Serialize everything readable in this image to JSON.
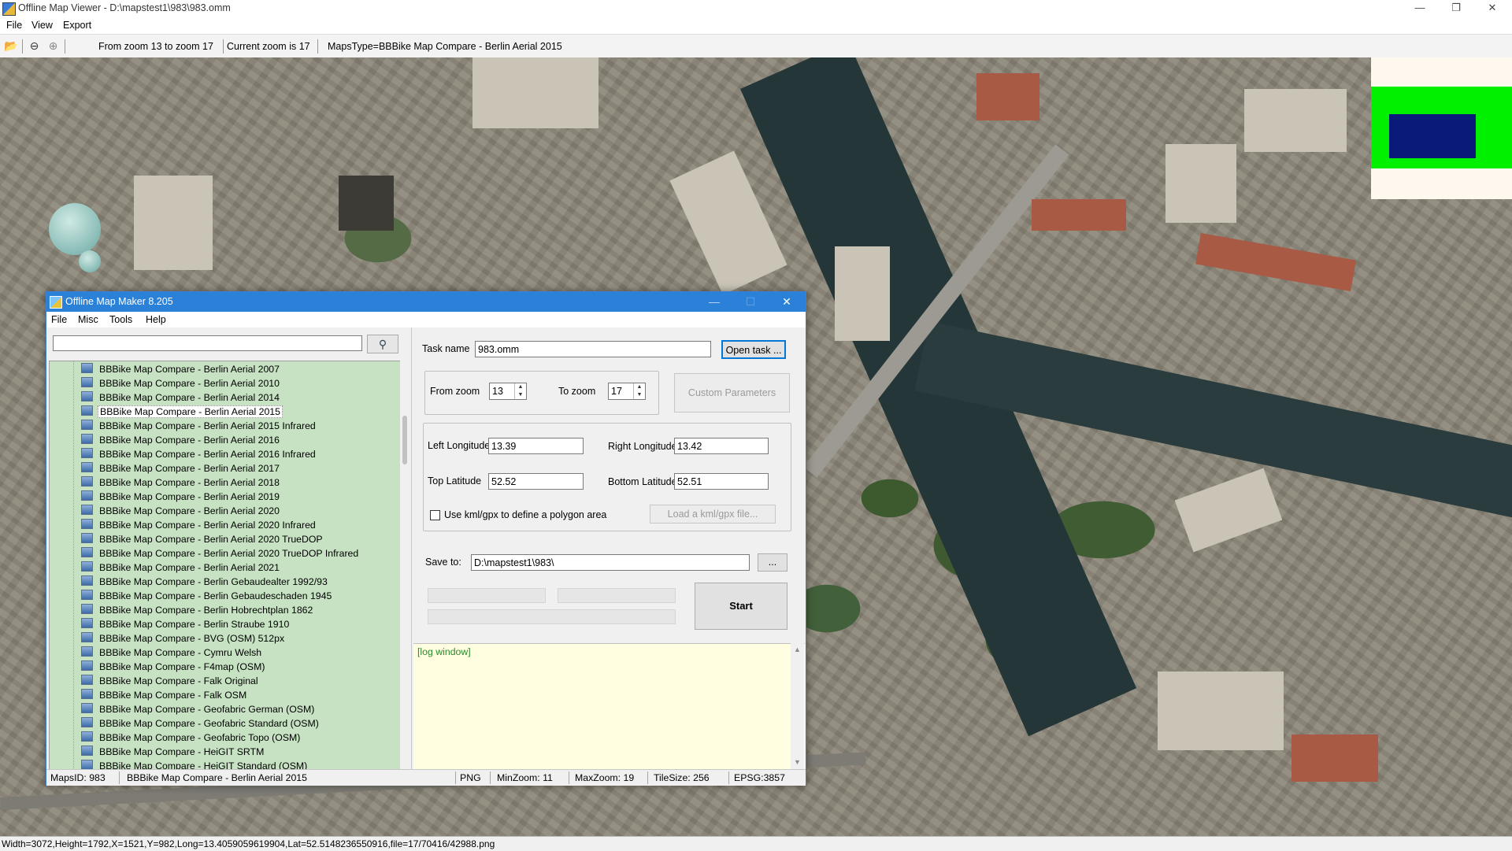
{
  "viewer": {
    "title": "Offline Map Viewer - D:\\mapstest1\\983\\983.omm",
    "menu": [
      "File",
      "View",
      "Export"
    ],
    "toolbar": {
      "zoom_range": "From zoom 13 to zoom 17",
      "current_zoom": "Current zoom is 17",
      "maps_type": "MapsType=BBBike Map Compare - Berlin Aerial 2015"
    },
    "window_buttons": {
      "minimize": "—",
      "restore": "❐",
      "close": "✕"
    },
    "status": "Width=3072,Height=1792,X=1521,Y=982,Long=13.4059059619904,Lat=52.5148236550916,file=17/70416/42988.png"
  },
  "dialog": {
    "title": "Offline Map Maker 8.205",
    "menu": [
      "File",
      "Misc",
      "Tools",
      "Help"
    ],
    "window_buttons": {
      "minimize": "—",
      "maximize": "☐",
      "close": "✕"
    },
    "search": {
      "value": "",
      "icon": "search-icon"
    },
    "map_list": [
      "BBBike Map Compare - Berlin Aerial 2007",
      "BBBike Map Compare - Berlin Aerial 2010",
      "BBBike Map Compare - Berlin Aerial 2014",
      "BBBike Map Compare - Berlin Aerial 2015",
      "BBBike Map Compare - Berlin Aerial 2015 Infrared",
      "BBBike Map Compare - Berlin Aerial 2016",
      "BBBike Map Compare - Berlin Aerial 2016 Infrared",
      "BBBike Map Compare - Berlin Aerial 2017",
      "BBBike Map Compare - Berlin Aerial 2018",
      "BBBike Map Compare - Berlin Aerial 2019",
      "BBBike Map Compare - Berlin Aerial 2020",
      "BBBike Map Compare - Berlin Aerial 2020 Infrared",
      "BBBike Map Compare - Berlin Aerial 2020 TrueDOP",
      "BBBike Map Compare - Berlin Aerial 2020 TrueDOP Infrared",
      "BBBike Map Compare - Berlin Aerial 2021",
      "BBBike Map Compare - Berlin Gebaudealter 1992/93",
      "BBBike Map Compare - Berlin Gebaudeschaden 1945",
      "BBBike Map Compare - Berlin Hobrechtplan 1862",
      "BBBike Map Compare - Berlin Straube 1910",
      "BBBike Map Compare - BVG (OSM) 512px",
      "BBBike Map Compare - Cymru Welsh",
      "BBBike Map Compare - F4map (OSM)",
      "BBBike Map Compare - Falk Original",
      "BBBike Map Compare - Falk OSM",
      "BBBike Map Compare - Geofabric German (OSM)",
      "BBBike Map Compare - Geofabric Standard (OSM)",
      "BBBike Map Compare - Geofabric Topo (OSM)",
      "BBBike Map Compare - HeiGIT SRTM",
      "BBBike Map Compare - HeiGIT Standard (OSM)"
    ],
    "selected_index": 3,
    "task_name_label": "Task name",
    "task_name": "983.omm",
    "open_task": "Open task ...",
    "from_zoom_label": "From zoom",
    "from_zoom": "13",
    "to_zoom_label": "To zoom",
    "to_zoom": "17",
    "custom_parameters": "Custom Parameters",
    "left_longitude_label": "Left Longitude",
    "left_longitude": "13.39",
    "right_longitude_label": "Right Longitude",
    "right_longitude": "13.42",
    "top_latitude_label": "Top Latitude",
    "top_latitude": "52.52",
    "bottom_latitude_label": "Bottom Latitude",
    "bottom_latitude": "52.51",
    "use_kml_label": "Use kml/gpx to define a polygon area",
    "use_kml_checked": false,
    "load_kml": "Load a kml/gpx file...",
    "save_to_label": "Save to:",
    "save_to": "D:\\mapstest1\\983\\",
    "browse": "...",
    "start": "Start",
    "log": "[log window]",
    "status": {
      "maps_id": "MapsID: 983",
      "maps_name": "BBBike Map Compare - Berlin Aerial 2015",
      "format": "PNG",
      "min_zoom": "MinZoom: 11",
      "max_zoom": "MaxZoom: 19",
      "tile_size": "TileSize: 256",
      "epsg": "EPSG:3857"
    }
  },
  "colors": {
    "dialog_titlebar": "#2b80d8",
    "tree_background": "#c6e2c2",
    "log_background": "#fffee0",
    "overview_frame": "#00f000",
    "overview_viewport": "#0a1a78"
  }
}
